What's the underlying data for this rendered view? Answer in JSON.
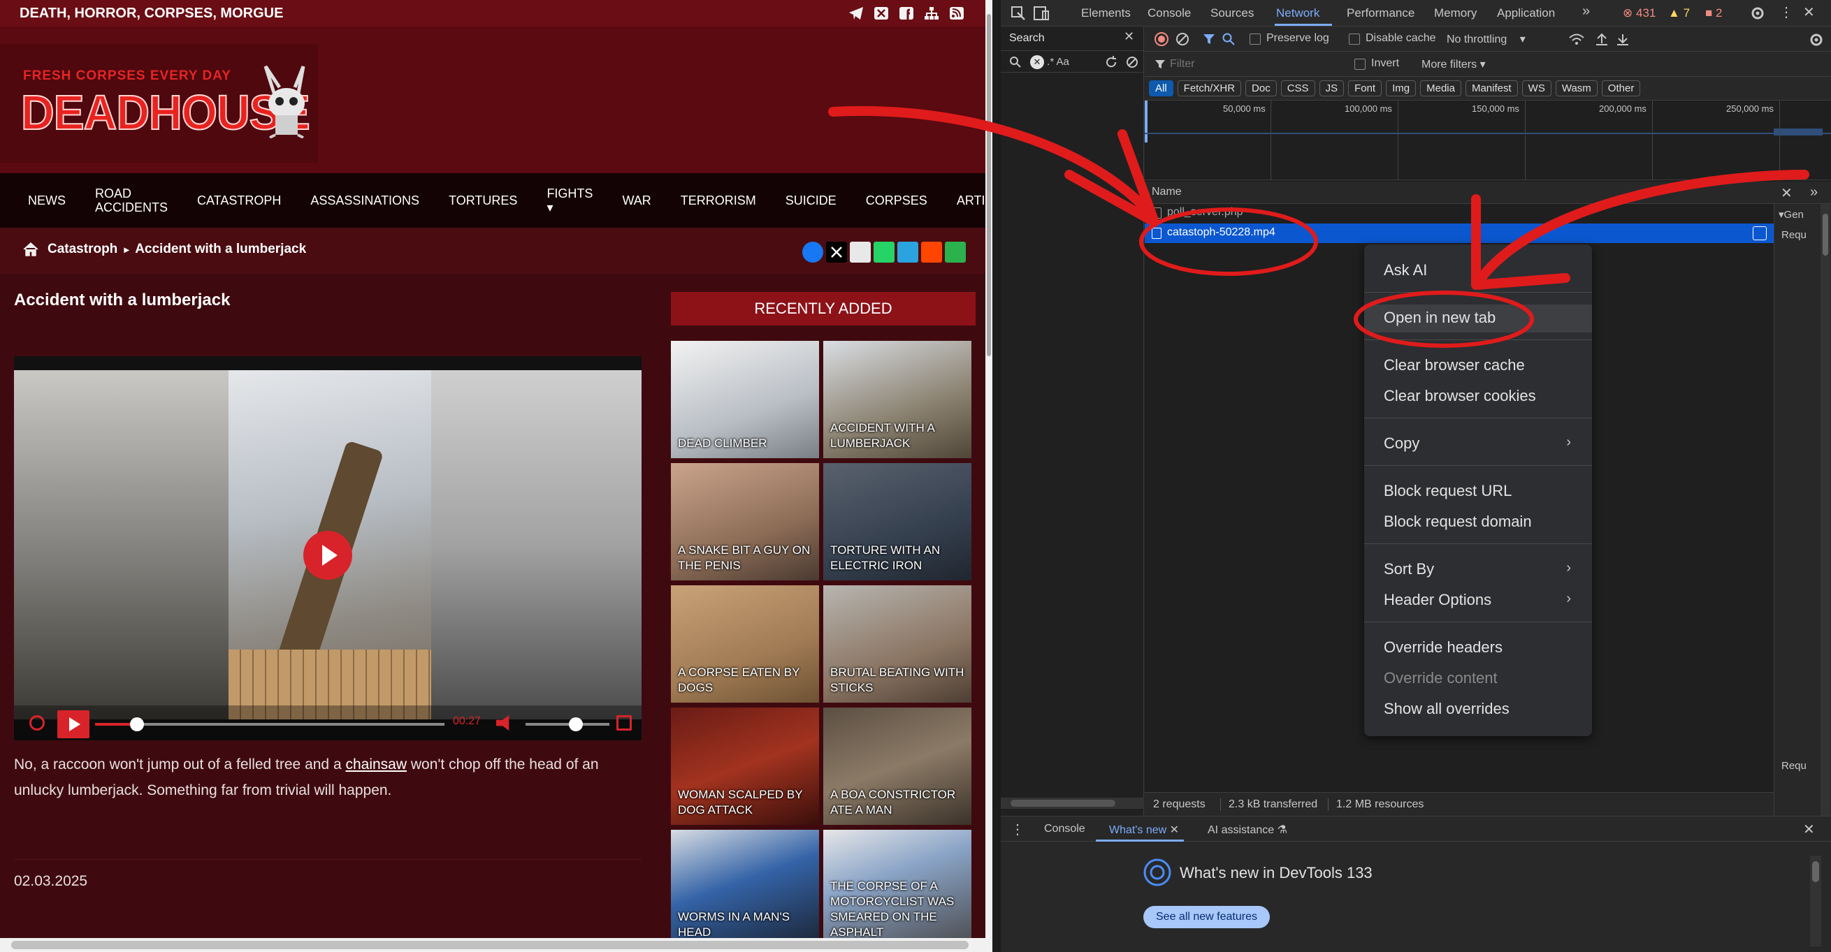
{
  "site": {
    "topbar_text": "DEATH, HORROR, CORPSES, MORGUE",
    "tagline": "FRESH CORPSES EVERY DAY",
    "logo_text": "DEADHOUSE",
    "nav": [
      "NEWS",
      "ROAD\nACCIDENTS",
      "CATASTROPH",
      "ASSASSINATIONS",
      "TORTURES",
      "FIGHTS ▾",
      "WAR",
      "TERRORISM",
      "SUICIDE",
      "CORPSES",
      "ARTICLE"
    ],
    "breadcrumb_section": "Catastroph",
    "breadcrumb_sep": "▸",
    "breadcrumb_page": "Accident with a lumberjack",
    "article_title": "Accident with a lumberjack",
    "player": {
      "time": "00:27",
      "progress": 0.12,
      "volume": 0.6
    },
    "body_before": "No, a raccoon won't jump out of a felled tree and a ",
    "body_link": "chainsaw",
    "body_after": " won't chop off the head of an unlucky lumberjack. Something far from trivial will happen.",
    "date": "02.03.2025",
    "recently_added": "RECENTLY ADDED",
    "cards": [
      "DEAD CLIMBER",
      "ACCIDENT WITH A LUMBERJACK",
      "A SNAKE BIT A GUY ON THE PENIS",
      "TORTURE WITH AN ELECTRIC IRON",
      "A CORPSE EATEN BY DOGS",
      "BRUTAL BEATING WITH STICKS",
      "WOMAN SCALPED BY DOG ATTACK",
      "A BOA CONSTRICTOR ATE A MAN",
      "WORMS IN A MAN'S HEAD",
      "THE CORPSE OF A MOTORCYCLIST WAS SMEARED ON THE ASPHALT"
    ],
    "colors": {
      "accent": "#d9232a",
      "bg": "#3f0a0f",
      "nav": "#130304"
    }
  },
  "devtools": {
    "tabs": [
      "Elements",
      "Console",
      "Sources",
      "Network",
      "Performance",
      "Memory",
      "Application"
    ],
    "more_tabs": "»",
    "errors": "431",
    "warnings": "7",
    "issues": "2",
    "search_title": "Search",
    "search_opts": ".*  Aa",
    "preserve_log": "Preserve log",
    "disable_cache": "Disable cache",
    "throttling": "No throttling",
    "filter_placeholder": "Filter",
    "invert": "Invert",
    "more_filters": "More filters",
    "types": [
      "All",
      "Fetch/XHR",
      "Doc",
      "CSS",
      "JS",
      "Font",
      "Img",
      "Media",
      "Manifest",
      "WS",
      "Wasm",
      "Other"
    ],
    "timeline_labels": [
      "50,000 ms",
      "100,000 ms",
      "150,000 ms",
      "200,000 ms",
      "250,000 ms"
    ],
    "name_header": "Name",
    "requests": [
      "poll_server.php",
      "catastoph-50228.mp4"
    ],
    "detail_labels": [
      "Gen",
      "Requ",
      "Requ"
    ],
    "status_requests": "2 requests",
    "status_transferred": "2.3 kB transferred",
    "status_resources": "1.2 MB resources",
    "drawer_tabs": [
      "Console",
      "What's new",
      "AI assistance"
    ],
    "whats_new_title": "What's new in DevTools 133",
    "see_all": "See all new features"
  },
  "context_menu": {
    "items": [
      {
        "label": "Ask AI"
      },
      {
        "label": "Open in new tab",
        "highlighted": true
      },
      {
        "label": "Clear browser cache"
      },
      {
        "label": "Clear browser cookies"
      },
      {
        "label": "Copy",
        "submenu": true
      },
      {
        "label": "Block request URL"
      },
      {
        "label": "Block request domain"
      },
      {
        "label": "Sort By",
        "submenu": true
      },
      {
        "label": "Header Options",
        "submenu": true
      },
      {
        "label": "Override headers"
      },
      {
        "label": "Override content",
        "disabled": true
      },
      {
        "label": "Show all overrides"
      }
    ]
  }
}
